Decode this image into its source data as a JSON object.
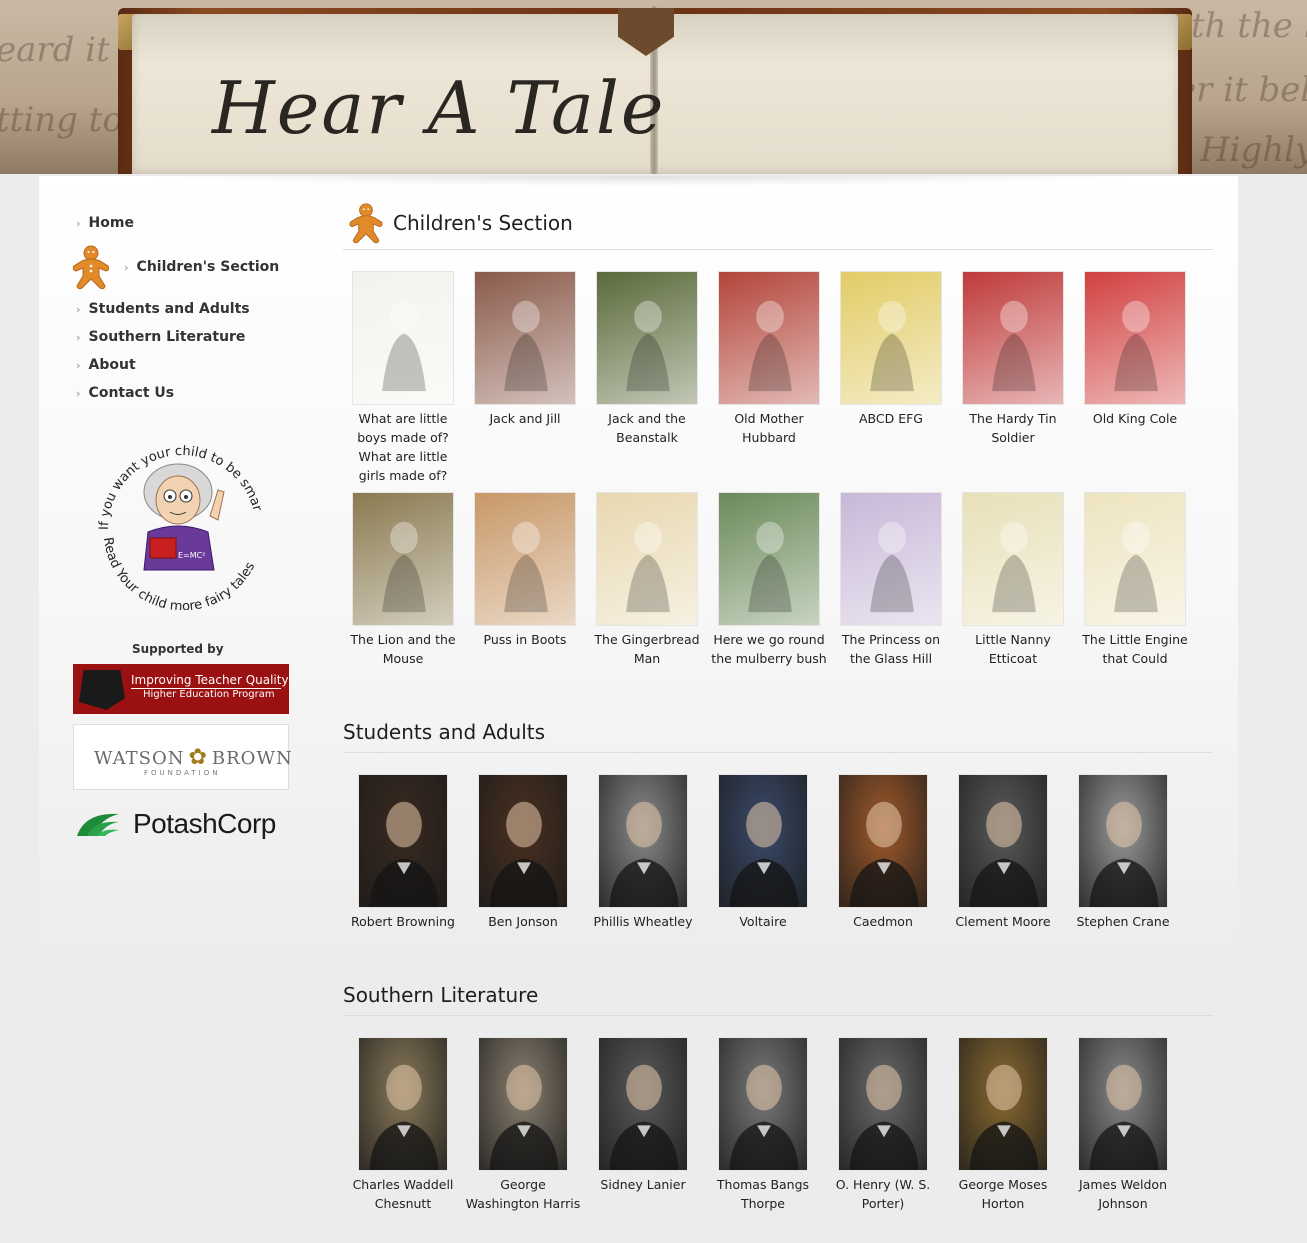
{
  "site": {
    "title": "Hear A Tale"
  },
  "nav": {
    "items": [
      {
        "label": "Home"
      },
      {
        "label": "Children's Section"
      },
      {
        "label": "Students and Adults"
      },
      {
        "label": "Southern Literature"
      },
      {
        "label": "About"
      },
      {
        "label": "Contact Us"
      }
    ]
  },
  "badge": {
    "top_text": "If you want your child to be smarter",
    "bottom_text": "Read Your child more fairy tales"
  },
  "sponsors": {
    "heading": "Supported by",
    "itq_line1": "Improving Teacher Quality",
    "itq_line2": "Higher Education Program",
    "itq_state": "Georgia",
    "wb_name_left": "WATSON",
    "wb_name_right": "BROWN",
    "wb_sub": "FOUNDATION",
    "potash": "PotashCorp"
  },
  "children": {
    "heading": "Children's Section",
    "items": [
      {
        "caption": "What are little boys made of? What are little girls made of?",
        "color": "#f4f2ec"
      },
      {
        "caption": "Jack and Jill",
        "color": "#8a5a4a"
      },
      {
        "caption": "Jack and the Beanstalk",
        "color": "#5a6a3a"
      },
      {
        "caption": "Old Mother Hubbard",
        "color": "#b3453a"
      },
      {
        "caption": "ABCD EFG",
        "color": "#e2cc66"
      },
      {
        "caption": "The Hardy Tin Soldier",
        "color": "#c03a3a"
      },
      {
        "caption": "Old King Cole",
        "color": "#d24040"
      },
      {
        "caption": "The Lion and the Mouse",
        "color": "#8a7a50"
      },
      {
        "caption": "Puss in Boots",
        "color": "#c89868"
      },
      {
        "caption": "The Gingerbread Man",
        "color": "#e8d8b0"
      },
      {
        "caption": "Here we go round the mulberry bush",
        "color": "#6a8a5a"
      },
      {
        "caption": "The Princess on the Glass Hill",
        "color": "#c8b8d8"
      },
      {
        "caption": "Little Nanny Etticoat",
        "color": "#e8e0b8"
      },
      {
        "caption": "The Little Engine that Could",
        "color": "#eee4c0"
      }
    ]
  },
  "students": {
    "heading": "Students and Adults",
    "items": [
      {
        "caption": "Robert Browning",
        "color": "#3a2a20"
      },
      {
        "caption": "Ben Jonson",
        "color": "#4a3020"
      },
      {
        "caption": "Phillis Wheatley",
        "color": "#8a8a8a"
      },
      {
        "caption": "Voltaire",
        "color": "#3a4a6a"
      },
      {
        "caption": "Caedmon",
        "color": "#a05a2a"
      },
      {
        "caption": "Clement Moore",
        "color": "#5a5a5a"
      },
      {
        "caption": "Stephen Crane",
        "color": "#9a9a9a"
      }
    ]
  },
  "southern": {
    "heading": "Southern Literature",
    "items": [
      {
        "caption": "Charles Waddell Chesnutt",
        "color": "#8a7a5a"
      },
      {
        "caption": "George Washington Harris",
        "color": "#8a8070"
      },
      {
        "caption": "Sidney Lanier",
        "color": "#5a5a5a"
      },
      {
        "caption": "Thomas Bangs Thorpe",
        "color": "#7a7a7a"
      },
      {
        "caption": "O. Henry (W. S. Porter)",
        "color": "#6a6a6a"
      },
      {
        "caption": "George Moses Horton",
        "color": "#8a6a30"
      },
      {
        "caption": "James Weldon Johnson",
        "color": "#8a8a8a"
      }
    ]
  }
}
